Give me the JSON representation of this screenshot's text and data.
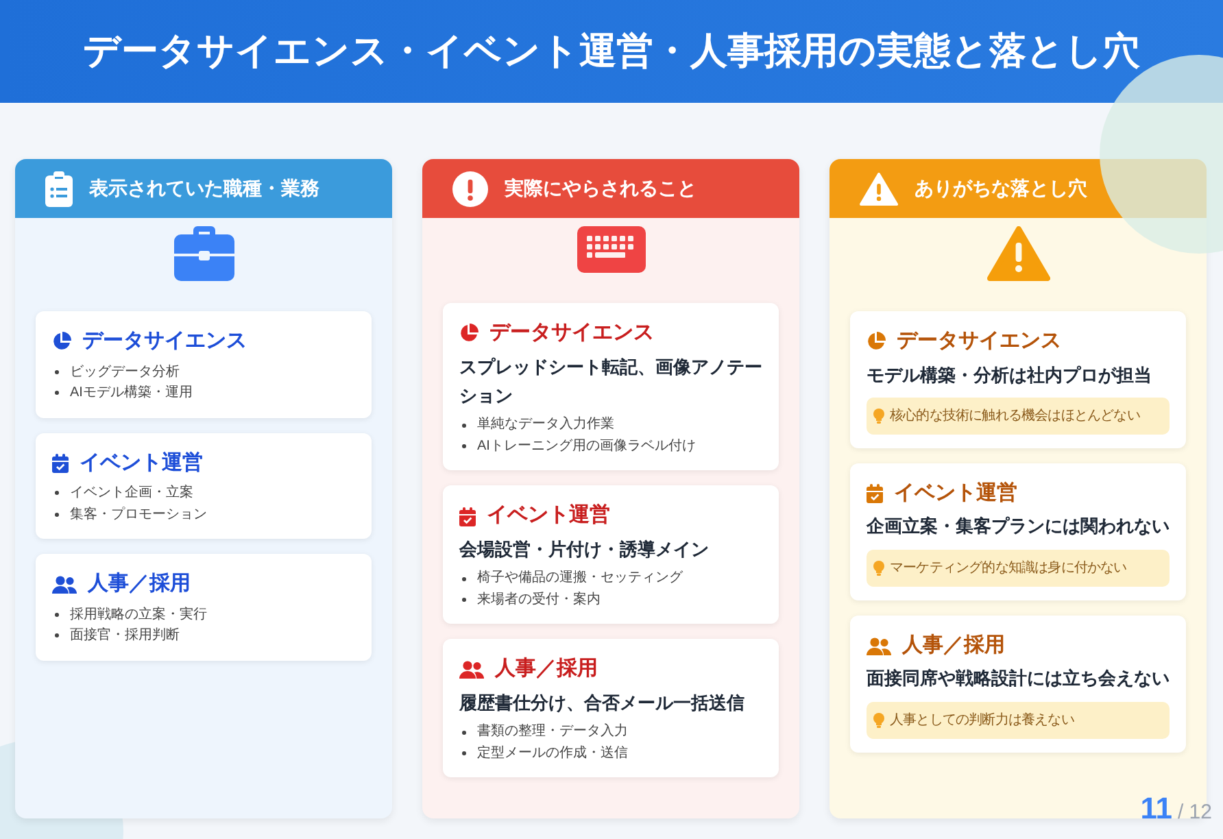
{
  "title": "データサイエンス・イベント運営・人事採用の実態と落とし穴",
  "columns": [
    {
      "kind": "info",
      "heading": "表示されていた職種・業務",
      "items": [
        {
          "name": "データサイエンス",
          "bullets": [
            "ビッグデータ分析",
            "AIモデル構築・運用"
          ]
        },
        {
          "name": "イベント運営",
          "bullets": [
            "イベント企画・立案",
            "集客・プロモーション"
          ]
        },
        {
          "name": "人事／採用",
          "bullets": [
            "採用戦略の立案・実行",
            "面接官・採用判断"
          ]
        }
      ]
    },
    {
      "kind": "danger",
      "heading": "実際にやらされること",
      "items": [
        {
          "name": "データサイエンス",
          "summary": "スプレッドシート転記、画像アノテーション",
          "bullets": [
            "単純なデータ入力作業",
            "AIトレーニング用の画像ラベル付け"
          ]
        },
        {
          "name": "イベント運営",
          "summary": "会場設営・片付け・誘導メイン",
          "bullets": [
            "椅子や備品の運搬・セッティング",
            "来場者の受付・案内"
          ]
        },
        {
          "name": "人事／採用",
          "summary": "履歴書仕分け、合否メール一括送信",
          "bullets": [
            "書類の整理・データ入力",
            "定型メールの作成・送信"
          ]
        }
      ]
    },
    {
      "kind": "warning",
      "heading": "ありがちな落とし穴",
      "items": [
        {
          "name": "データサイエンス",
          "summary": "モデル構築・分析は社内プロが担当",
          "tip": "核心的な技術に触れる機会はほとんどない"
        },
        {
          "name": "イベント運営",
          "summary": "企画立案・集客プランには関われない",
          "tip": "マーケティング的な知識は身に付かない"
        },
        {
          "name": "人事／採用",
          "summary": "面接同席や戦略設計には立ち会えない",
          "tip": "人事としての判断力は養えない"
        }
      ]
    }
  ],
  "page": {
    "current": "11",
    "total": "/ 12"
  }
}
